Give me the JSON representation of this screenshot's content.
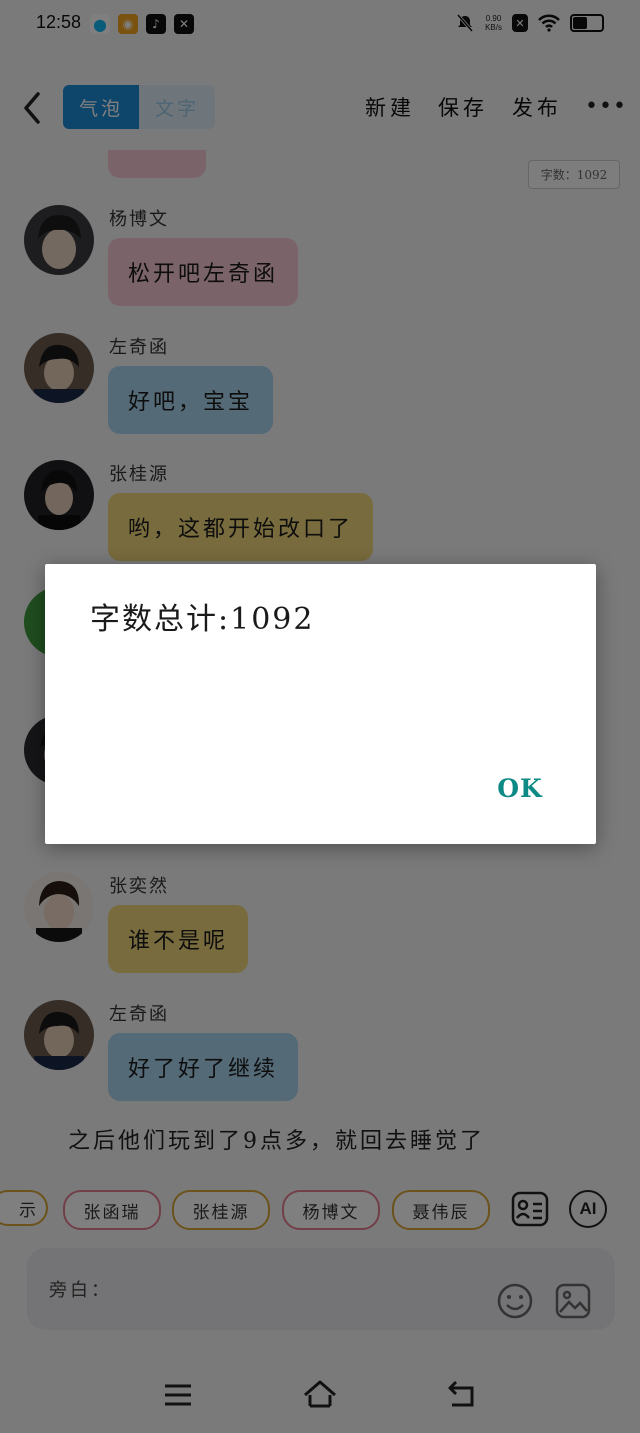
{
  "status_bar": {
    "time": "12:58",
    "net_speed_value": "0.90",
    "net_speed_unit": "KB/s"
  },
  "header": {
    "tab_bubble": "气泡",
    "tab_text": "文字",
    "new_label": "新建",
    "save_label": "保存",
    "publish_label": "发布",
    "more_label": "•••"
  },
  "word_count_tag": "字数：1092",
  "messages": [
    {
      "sender": "杨博文",
      "text": "松开吧左奇函",
      "bubble_color": "#f6c9d2"
    },
    {
      "sender": "左奇函",
      "text": "好吧，宝宝",
      "bubble_color": "#a8d4ef"
    },
    {
      "sender": "张桂源",
      "text": "哟，这都开始改口了",
      "bubble_color": "#f1d67a"
    },
    {
      "sender": "张奕然",
      "text": "谁不是呢",
      "bubble_color": "#f1d67a"
    },
    {
      "sender": "左奇函",
      "text": "好了好了继续",
      "bubble_color": "#a8d4ef"
    }
  ],
  "narration": "之后他们玩到了9点多，就回去睡觉了",
  "character_chips": [
    {
      "name": "张函瑞",
      "color": "#e57f93"
    },
    {
      "name": "张桂源",
      "color": "#d8a637"
    },
    {
      "name": "杨博文",
      "color": "#e57f93"
    },
    {
      "name": "聂伟辰",
      "color": "#d8a637"
    }
  ],
  "ai_button_label": "AI",
  "input": {
    "label": "旁白："
  },
  "dialog": {
    "message": "字数总计:1092",
    "ok_label": "OK"
  },
  "icons": {
    "back": "back-chevron-icon",
    "contact_card": "contact-card-icon",
    "emoji": "emoji-icon",
    "image": "image-icon",
    "nav_menu": "menu-icon",
    "nav_home": "home-icon",
    "nav_back": "return-icon"
  }
}
